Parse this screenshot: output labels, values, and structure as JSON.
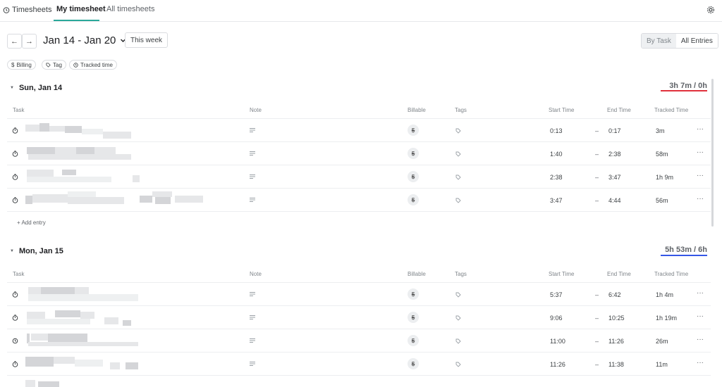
{
  "nav": {
    "brand": "Timesheets",
    "tabs": [
      {
        "label": "My timesheet",
        "active": true
      },
      {
        "label": "All timesheets",
        "active": false
      }
    ]
  },
  "week": {
    "prev_label": "←",
    "next_label": "→",
    "range": "Jan 14 - Jan 20",
    "this_week": "This week"
  },
  "view": {
    "by_task": "By Task",
    "all_entries": "All Entries",
    "selected": "By Task"
  },
  "filters": [
    {
      "icon": "dollar-icon",
      "label": "Billing"
    },
    {
      "icon": "tag-icon",
      "label": "Tag"
    },
    {
      "icon": "clock-icon",
      "label": "Tracked time"
    }
  ],
  "columns": {
    "task": "Task",
    "note": "Note",
    "billable": "Billable",
    "tags": "Tags",
    "start": "Start Time",
    "end": "End Time",
    "tracked": "Tracked Time"
  },
  "colors": {
    "accent": "#2aa89a",
    "underline_over_target": "#e0303c",
    "underline_on_target": "#3557e6"
  },
  "days": [
    {
      "label": "Sun, Jan 14",
      "tracked": "3h 7m",
      "target": "0h",
      "entries": [
        {
          "start": "0:13",
          "end": "0:17",
          "tracked": "3m"
        },
        {
          "start": "1:40",
          "end": "2:38",
          "tracked": "58m"
        },
        {
          "start": "2:38",
          "end": "3:47",
          "tracked": "1h 9m"
        },
        {
          "start": "3:47",
          "end": "4:44",
          "tracked": "56m"
        }
      ],
      "add_entry": "+ Add entry"
    },
    {
      "label": "Mon, Jan 15",
      "tracked": "5h 53m",
      "target": "6h",
      "entries": [
        {
          "start": "5:37",
          "end": "6:42",
          "tracked": "1h 4m"
        },
        {
          "start": "9:06",
          "end": "10:25",
          "tracked": "1h 19m"
        },
        {
          "start": "11:00",
          "end": "11:26",
          "tracked": "26m"
        },
        {
          "start": "11:26",
          "end": "11:38",
          "tracked": "11m"
        }
      ]
    }
  ],
  "billable_glyph": "$",
  "dash": "–",
  "more_glyph": "···"
}
